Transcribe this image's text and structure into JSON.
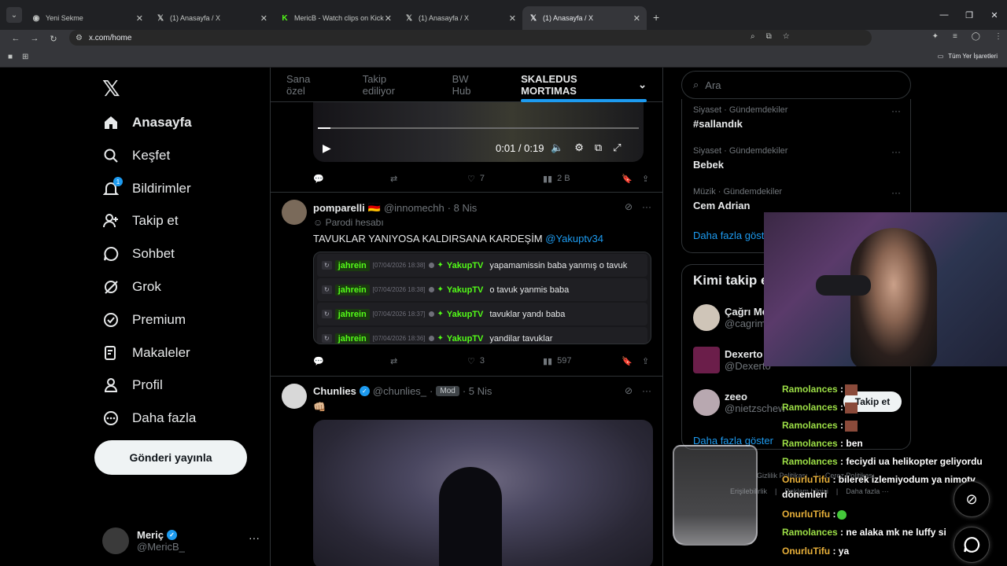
{
  "browser": {
    "tabs": [
      {
        "title": "Yeni Sekme",
        "favicon": "chrome-icon"
      },
      {
        "title": "(1) Anasayfa / X",
        "favicon": "x-icon"
      },
      {
        "title": "MericB - Watch clips on Kick",
        "favicon": "kick-icon"
      },
      {
        "title": "(1) Anasayfa / X",
        "favicon": "x-icon"
      },
      {
        "title": "(1) Anasayfa / X",
        "favicon": "x-icon"
      }
    ],
    "url": "x.com/home",
    "bookmarks_all": "Tüm Yer İşaretleri"
  },
  "nav": {
    "items": [
      {
        "label": "Anasayfa",
        "icon": "home-icon"
      },
      {
        "label": "Keşfet",
        "icon": "search-icon"
      },
      {
        "label": "Bildirimler",
        "icon": "bell-icon",
        "badge": "1"
      },
      {
        "label": "Takip et",
        "icon": "add-user-icon"
      },
      {
        "label": "Sohbet",
        "icon": "chat-icon"
      },
      {
        "label": "Grok",
        "icon": "grok-icon"
      },
      {
        "label": "Premium",
        "icon": "premium-icon"
      },
      {
        "label": "Makaleler",
        "icon": "articles-icon"
      },
      {
        "label": "Profil",
        "icon": "user-icon"
      },
      {
        "label": "Daha fazla",
        "icon": "more-icon"
      }
    ],
    "post_button": "Gönderi yayınla",
    "account": {
      "name": "Meriç",
      "handle": "@MericB_"
    }
  },
  "feed": {
    "tabs": [
      "Sana özel",
      "Takip ediliyor",
      "BW Hub",
      "SKALEDUS MORTIMAS"
    ],
    "video1": {
      "time": "0:01 / 0:19",
      "progress": 0.04
    },
    "post1_stats": {
      "likes": "7",
      "views": "2 B"
    },
    "post2": {
      "name": "pomparelli",
      "flag": "🇩🇪",
      "handle": "@innomechh",
      "date": "· 8 Nis",
      "parody": "Parodi hesabı",
      "text": "TAVUKLAR YANIYOSA KALDIRSANA KARDEŞİM",
      "mention": "@Yakuptv34",
      "chat": [
        {
          "user": "jahrein",
          "ts": "[07/04/2026 18:38]",
          "to": "YakupTV",
          "msg": "yapamamissin baba yanmış o tavuk"
        },
        {
          "user": "jahrein",
          "ts": "[07/04/2026 18:38]",
          "to": "YakupTV",
          "msg": "o tavuk yanmis baba"
        },
        {
          "user": "jahrein",
          "ts": "[07/04/2026 18:37]",
          "to": "YakupTV",
          "msg": "tavuklar yandı baba"
        },
        {
          "user": "jahrein",
          "ts": "[07/04/2026 18:36]",
          "to": "YakupTV",
          "msg": "yandilar tavuklar"
        }
      ],
      "stats": {
        "likes": "3",
        "views": "597"
      }
    },
    "post3": {
      "name": "Chunlies",
      "handle": "@chunlies_",
      "mod": "Mod",
      "date": "· 5 Nis",
      "text": "👊🏼"
    }
  },
  "right": {
    "search_placeholder": "Ara",
    "trends": [
      {
        "category": "Siyaset · Gündemdekiler",
        "title": "#sallandık"
      },
      {
        "category": "Siyaset · Gündemdekiler",
        "title": "Bebek"
      },
      {
        "category": "Müzik · Gündemdekiler",
        "title": "Cem Adrian"
      }
    ],
    "trends_more": "Daha fazla göster",
    "who_title": "Kimi takip e",
    "who": [
      {
        "name": "Çağrı Me",
        "handle": "@cagrim"
      },
      {
        "name": "Dexerto",
        "handle": "@Dexerto"
      },
      {
        "name": "zeeo",
        "handle": "@nietzschew"
      }
    ],
    "follow_label": "Takip et",
    "who_more": "Daha fazla göster",
    "footer1": [
      "Gizlilik Politikası",
      "|",
      "Çerez Politikası"
    ],
    "footer2": [
      "Erişilebilirlik",
      "|",
      "Reklam bilgisi",
      "|",
      "Daha fazla ···"
    ]
  },
  "stream_chat": [
    {
      "user": "Ramolances",
      "sep": ":",
      "msg": "",
      "emote": true,
      "color": "#9cde46"
    },
    {
      "user": "Ramolances",
      "sep": ":",
      "msg": "",
      "emote": true,
      "color": "#9cde46"
    },
    {
      "user": "Ramolances",
      "sep": ":",
      "msg": "",
      "emote": true,
      "color": "#9cde46"
    },
    {
      "user": "Ramolances",
      "sep": ":",
      "msg": "ben",
      "emote": false,
      "color": "#9cde46"
    },
    {
      "user": "Ramolances",
      "sep": ":",
      "msg": "feciydi ua helikopter geliyordu",
      "emote": false,
      "color": "#9cde46"
    },
    {
      "user": "OnurluTifu",
      "sep": ":",
      "msg": "bilerek izlemiyodum ya nimotv",
      "emote": false,
      "color": "#e8b03a"
    },
    {
      "user": "",
      "sep": "",
      "msg": "dönemleri",
      "emote": false,
      "color": "#ffffff"
    },
    {
      "user": "OnurluTifu",
      "sep": ":",
      "msg": "",
      "emote2": true,
      "color": "#e8b03a"
    },
    {
      "user": "Ramolances",
      "sep": ":",
      "msg": "ne alaka mk ne luffy si",
      "emote": false,
      "color": "#9cde46"
    },
    {
      "user": "OnurluTifu",
      "sep": ":",
      "msg": "ya",
      "emote": false,
      "color": "#e8b03a"
    }
  ],
  "colors": {
    "accent": "#1d9bf0",
    "kick_green": "#53fc18"
  }
}
